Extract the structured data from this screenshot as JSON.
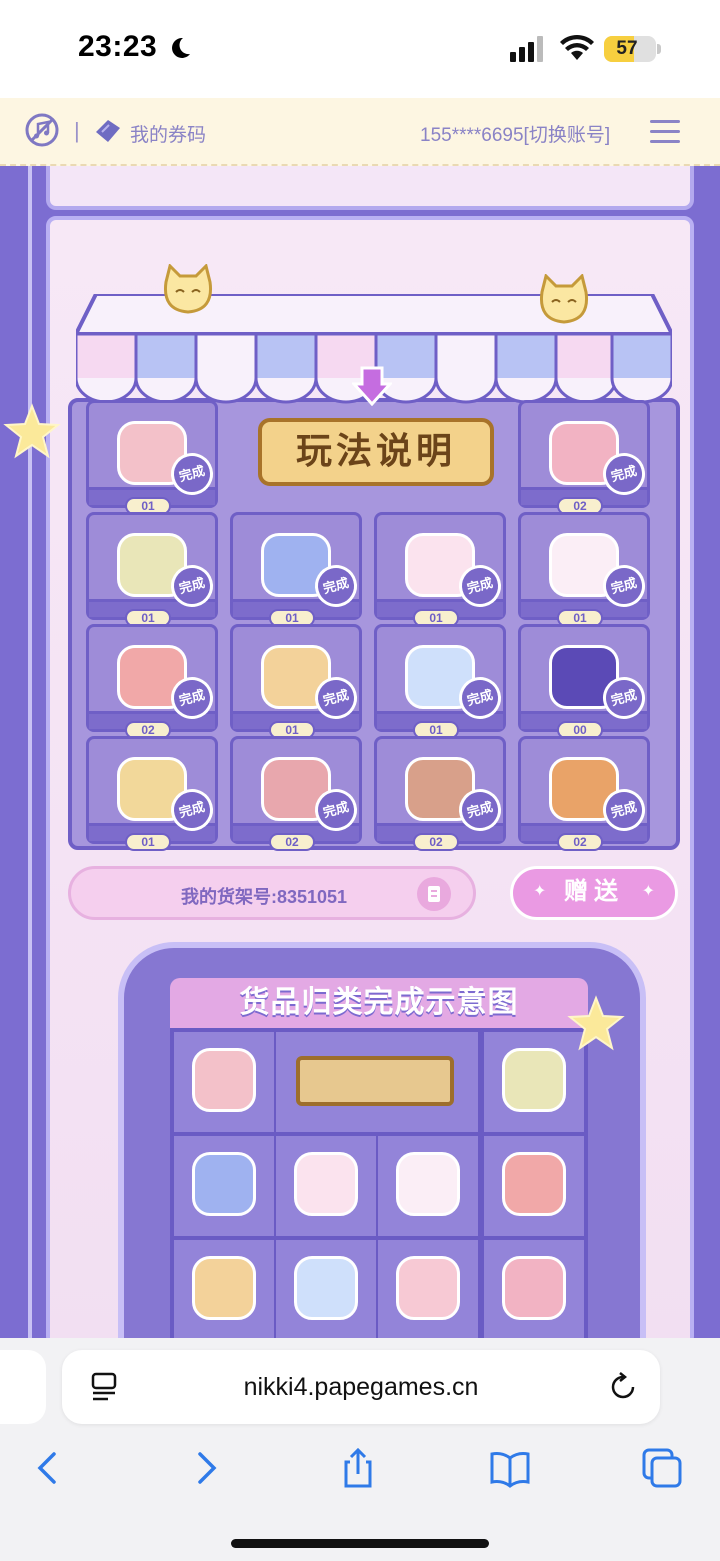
{
  "status": {
    "time": "23:23",
    "battery": "57",
    "battery_level": 0.57
  },
  "header": {
    "voucher_label": "我的券码",
    "separator": "|",
    "account": "155****6695[切换账号]"
  },
  "shelf": {
    "howto_label": "玩法说明",
    "done_label": "完成",
    "rows": [
      [
        {
          "item": "backpack-item",
          "count": "01"
        },
        null,
        null,
        {
          "item": "photo-album-item",
          "count": "02"
        }
      ],
      [
        {
          "item": "flower-box-item",
          "count": "01"
        },
        {
          "item": "perfume-bottle-item",
          "count": "01"
        },
        {
          "item": "shell-ring-item",
          "count": "01"
        },
        {
          "item": "bunny-mug-item",
          "count": "01"
        }
      ],
      [
        {
          "item": "bunny-cap-item",
          "count": "02"
        },
        {
          "item": "suitcase-item",
          "count": "01"
        },
        {
          "item": "crystal-ball-item",
          "count": "01"
        },
        {
          "item": "milk-carton-item",
          "count": "00"
        }
      ],
      [
        {
          "item": "moon-pillow-item",
          "count": "01"
        },
        {
          "item": "nikki-cosmetic-item",
          "count": "02"
        },
        {
          "item": "cake-slice-item",
          "count": "02"
        },
        {
          "item": "camera-item",
          "count": "02"
        }
      ]
    ],
    "shelf_number_label": "我的货架号:8351051",
    "gift_label": "赠送"
  },
  "diagram": {
    "title": "货品归类完成示意图"
  },
  "browser": {
    "url": "nikki4.papegames.cn"
  },
  "colors": {
    "purple_main": "#7c6dd1",
    "purple_border": "#6f5fc6",
    "pink_bg": "#f6e7f5",
    "gold": "#f3d28b"
  }
}
